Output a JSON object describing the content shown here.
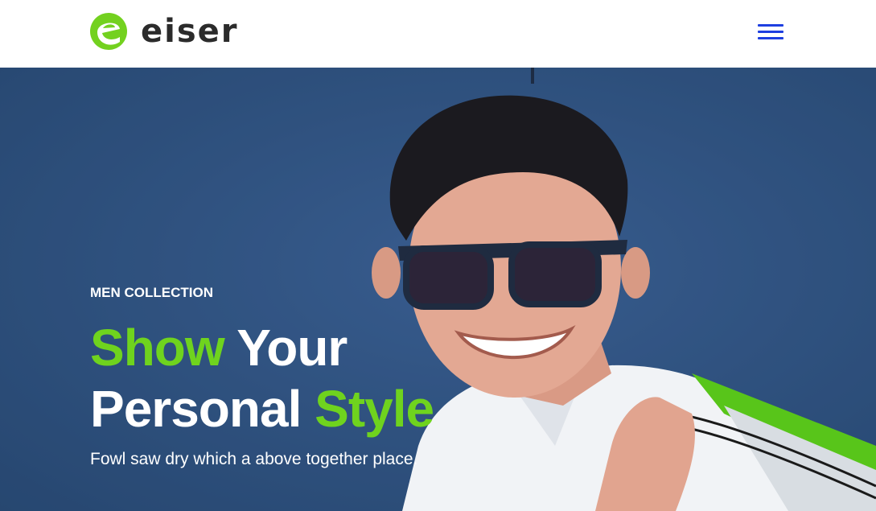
{
  "header": {
    "logo_text": "eiser",
    "logo_icon": "eiser-leaf-logo",
    "menu_icon": "hamburger-menu-icon"
  },
  "hero": {
    "tag": "MEN COLLECTION",
    "headline": {
      "word1": "Show",
      "word2": "Your",
      "word3": "Personal",
      "word4": "Style"
    },
    "description": "Fowl saw dry which a above together place.",
    "image": "man-with-sunglasses-holding-shopping-bag"
  },
  "colors": {
    "accent": "#6fd31e",
    "menu": "#1e3fe0",
    "hero_background": "#30527f",
    "logo_text": "#2b2b2b"
  }
}
